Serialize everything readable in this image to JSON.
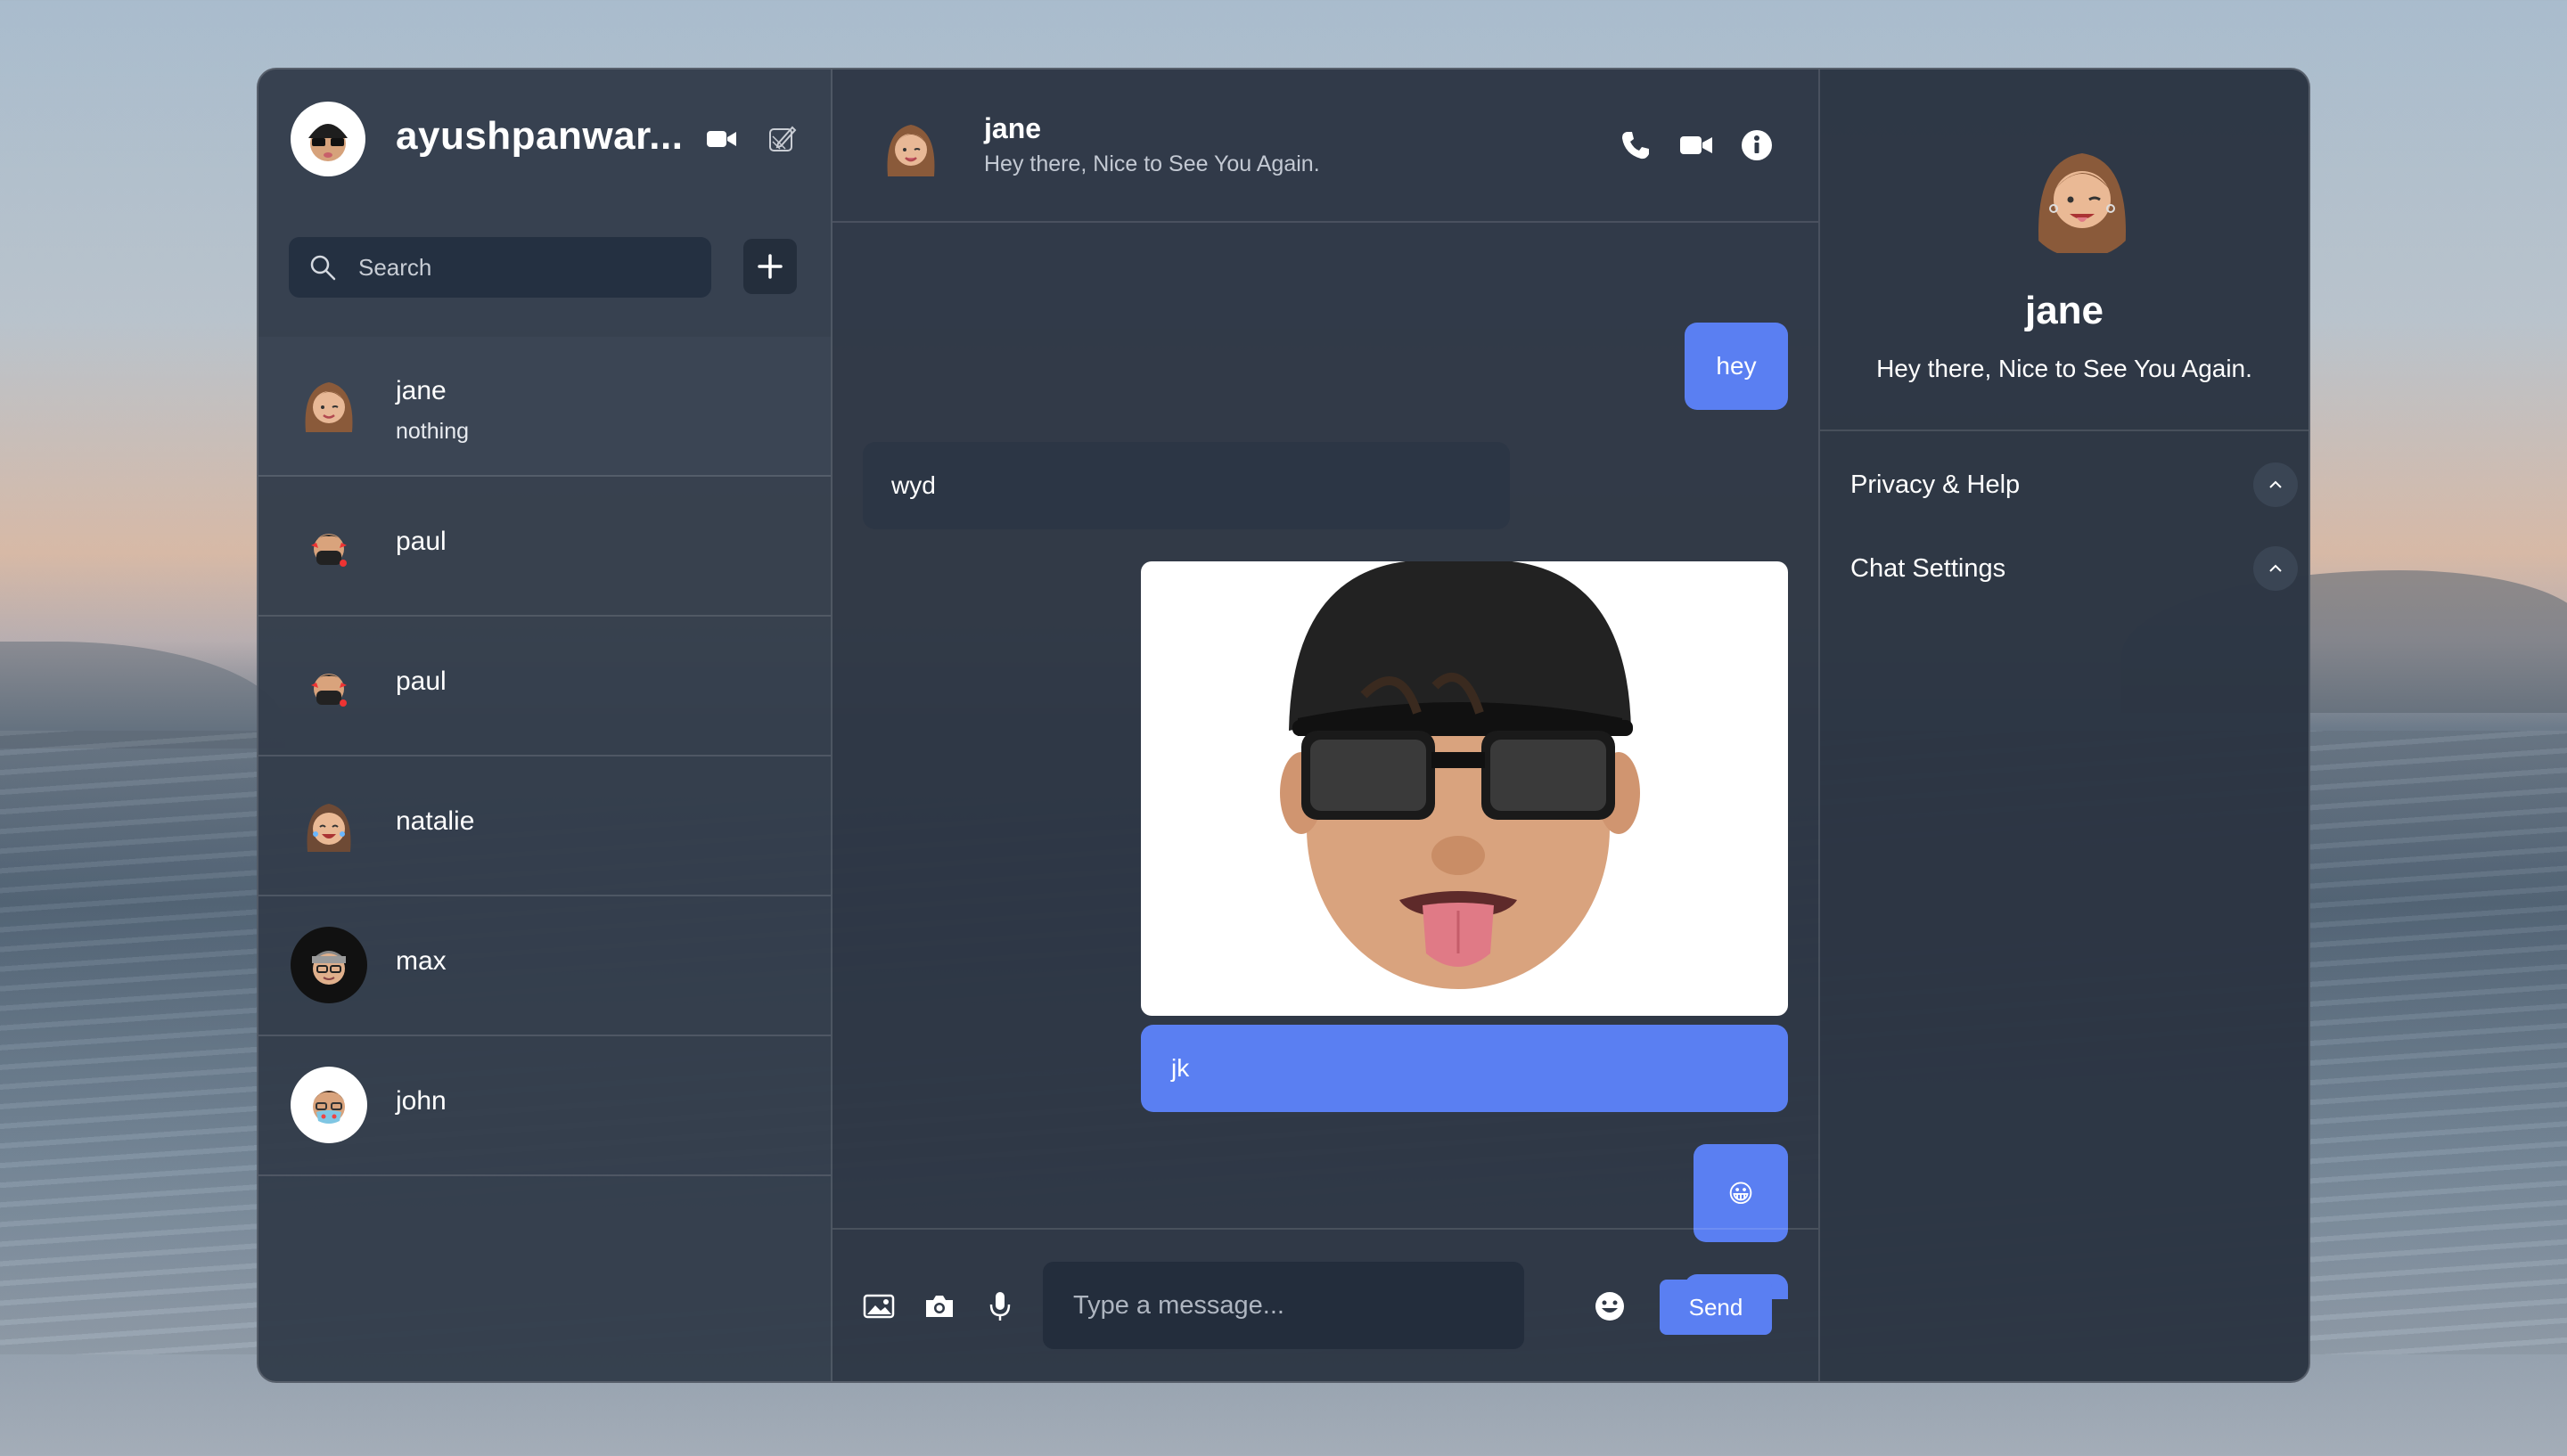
{
  "current_user": {
    "name": "ayushpanwar..."
  },
  "search": {
    "placeholder": "Search"
  },
  "contacts": [
    {
      "name": "jane",
      "last_message": "nothing"
    },
    {
      "name": "paul"
    },
    {
      "name": "paul"
    },
    {
      "name": "natalie"
    },
    {
      "name": "max"
    },
    {
      "name": "john"
    }
  ],
  "chat": {
    "contact_name": "jane",
    "status": "Hey there, Nice to See You Again.",
    "messages": [
      {
        "from": "me",
        "text": "hey"
      },
      {
        "from": "them",
        "text": "wyd"
      },
      {
        "from": "me",
        "type": "image"
      },
      {
        "from": "me",
        "text": "jk"
      },
      {
        "from": "me",
        "text": "😀"
      }
    ]
  },
  "composer": {
    "placeholder": "Type a message...",
    "send_label": "Send"
  },
  "details": {
    "name": "jane",
    "status": "Hey there, Nice to See You Again.",
    "sections": [
      {
        "label": "Privacy & Help"
      },
      {
        "label": "Chat Settings"
      }
    ]
  },
  "colors": {
    "accent": "#5a7ff2",
    "panel": "#2f3846"
  }
}
